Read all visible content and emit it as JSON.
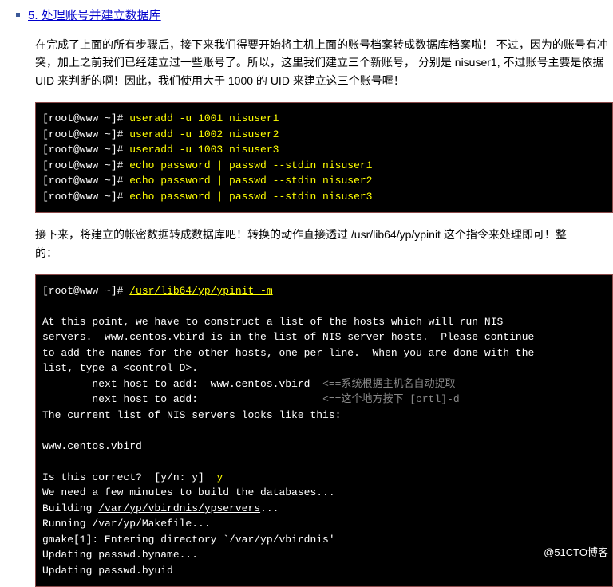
{
  "heading": "5. 处理账号并建立数据库",
  "para1": "在完成了上面的所有步骤后，接下来我们得要开始将主机上面的账号档案转成数据库档案啦！ 不过，因为的账号有冲突，加上之前我们已经建立过一些账号了。所以，这里我们建立三个新账号， 分别是 nisuser1, 不过账号主要是依据 UID 来判断的啊！因此，我们使用大于 1000 的 UID 来建立这三个账号喔！",
  "code1": {
    "l1p": "[root@www ~]# ",
    "l1c": "useradd -u 1001 nisuser1",
    "l2p": "[root@www ~]# ",
    "l2c": "useradd -u 1002 nisuser2",
    "l3p": "[root@www ~]# ",
    "l3c": "useradd -u 1003 nisuser3",
    "l4p": "[root@www ~]# ",
    "l4c": "echo password | passwd --stdin nisuser1",
    "l5p": "[root@www ~]# ",
    "l5c": "echo password | passwd --stdin nisuser2",
    "l6p": "[root@www ~]# ",
    "l6c": "echo password | passwd --stdin nisuser3"
  },
  "para2_a": "接下来，将建立的帐密数据转成数据库吧！转换的动作直接透过 ",
  "para2_b": "/usr/lib64/yp/ypinit",
  "para2_c": " 这个指令来处理即可！整",
  "para2_d": "的：",
  "code2": {
    "p1": "[root@www ~]# ",
    "c1": "/usr/lib64/yp/ypinit -m",
    "t1": "At this point, we have to construct a list of the hosts which will run NIS",
    "t2": "servers.  www.centos.vbird is in the list of NIS server hosts.  Please continue",
    "t3": "to add the names for the other hosts, one per line.  When you are done with the",
    "t4a": "list, type a ",
    "t4b": "<control D>",
    "t4c": ".",
    "t5a": "        next host to add:  ",
    "t5b": "www.centos.vbird",
    "t5c": "  <==系统根据主机名自动捉取",
    "t6a": "        next host to add:                    ",
    "t6b": "<==这个地方按下 [crtl]-d",
    "t7": "The current list of NIS servers looks like this:",
    "t8": "www.centos.vbird",
    "t9a": "Is this correct?  [y/n: y]  ",
    "t9b": "y",
    "t10": "We need a few minutes to build the databases...",
    "t11a": "Building ",
    "t11b": "/var/yp/vbirdnis/ypservers",
    "t11c": "...",
    "t12": "Running /var/yp/Makefile...",
    "t13": "gmake[1]: Entering directory `/var/yp/vbirdnis'",
    "t14": "Updating passwd.byname...",
    "t15": "Updating passwd.byuid"
  },
  "watermark": "@51CTO博客"
}
